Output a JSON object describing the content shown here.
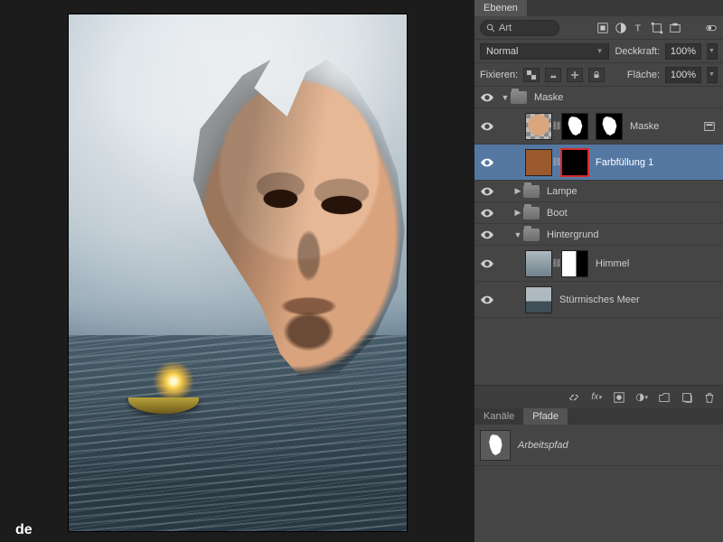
{
  "watermark": "de",
  "panel": {
    "tab": "Ebenen",
    "search_label": "Art",
    "blend_mode": "Normal",
    "opacity_label": "Deckkraft:",
    "opacity_value": "100%",
    "lock_label": "Fixieren:",
    "fill_label": "Fläche:",
    "fill_value": "100%"
  },
  "layers": {
    "group_maske": "Maske",
    "layer_maske": "Maske",
    "layer_fill": "Farbfüllung 1",
    "group_lampe": "Lampe",
    "group_boot": "Boot",
    "group_hintergrund": "Hintergrund",
    "layer_himmel": "Himmel",
    "layer_meer": "Stürmisches Meer"
  },
  "paths": {
    "tab_kanale": "Kanäle",
    "tab_pfade": "Pfade",
    "workpath": "Arbeitspfad"
  }
}
